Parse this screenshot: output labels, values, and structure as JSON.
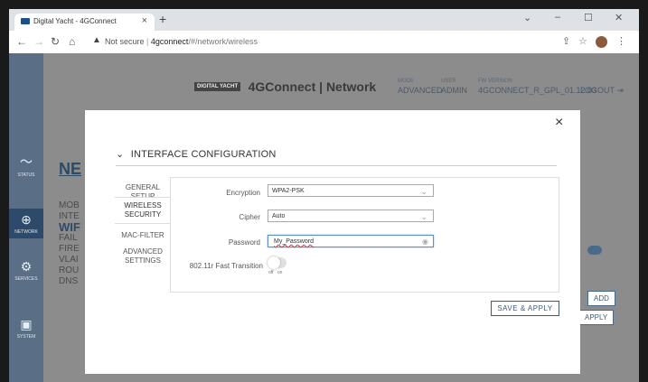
{
  "browser": {
    "tab_title": "Digital Yacht - 4GConnect",
    "tab_close": "×",
    "new_tab": "+",
    "url_warning": "Not secure",
    "url_host": "4gconnect",
    "url_path": "/#/network/wireless",
    "window_controls": {
      "minimize": "–",
      "maximize": "☐",
      "close": "✕",
      "chevron": "⌄"
    }
  },
  "app": {
    "logo_badge": "DIGITAL YACHT",
    "logo_name": "4GConnect | Network",
    "header": {
      "mode_label": "MODE",
      "mode_value": "ADVANCED",
      "user_label": "USER",
      "user_value": "ADMIN",
      "fw_label": "FW VERSION",
      "fw_value": "4GCONNECT_R_GPL_01.12.03",
      "logout": "LOGOUT"
    },
    "sidebar": [
      {
        "label": "STATUS",
        "icon": "pulse-icon"
      },
      {
        "label": "NETWORK",
        "icon": "globe-icon"
      },
      {
        "label": "SERVICES",
        "icon": "gear-icon"
      },
      {
        "label": "SYSTEM",
        "icon": "system-icon"
      }
    ],
    "background": {
      "title": "NE",
      "items": [
        "MOB",
        "INTE",
        "WIF",
        "FAIL",
        "FIRE",
        "VLAI",
        "ROU",
        "DNS"
      ],
      "add_btn": "ADD",
      "apply_btn": "APPLY"
    }
  },
  "modal": {
    "close": "×",
    "section_title": "INTERFACE CONFIGURATION",
    "tabs": [
      {
        "label": "GENERAL SETUP"
      },
      {
        "label": "WIRELESS SECURITY",
        "active": true
      },
      {
        "label": "MAC-FILTER"
      },
      {
        "label": "ADVANCED SETTINGS"
      }
    ],
    "fields": {
      "encryption": {
        "label": "Encryption",
        "value": "WPA2-PSK"
      },
      "cipher": {
        "label": "Cipher",
        "value": "Auto"
      },
      "password": {
        "label": "Password",
        "value": "My_Password"
      },
      "fast_transition": {
        "label": "802.11r Fast Transition",
        "off": "off",
        "on": "on",
        "state": "off"
      }
    },
    "save_button": "SAVE & APPLY"
  }
}
